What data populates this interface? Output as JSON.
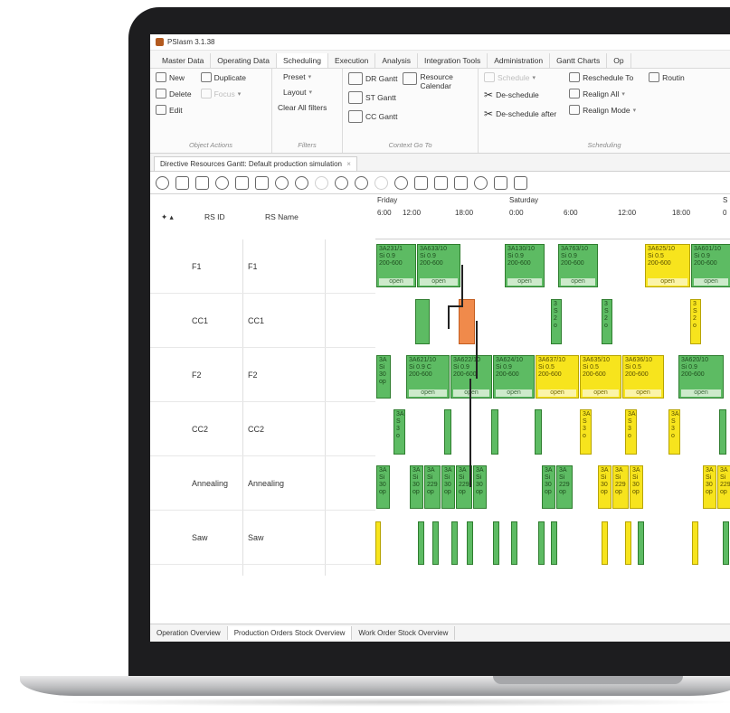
{
  "app": {
    "title": "PSIasm 3.1.38"
  },
  "menu_tabs": [
    "Master Data",
    "Operating Data",
    "Scheduling",
    "Execution",
    "Analysis",
    "Integration Tools",
    "Administration",
    "Gantt Charts",
    "Op"
  ],
  "ribbon": {
    "object_actions": {
      "new": "New",
      "duplicate": "Duplicate",
      "delete": "Delete",
      "focus": "Focus",
      "edit": "Edit",
      "label": "Object Actions"
    },
    "filters": {
      "preset": "Preset",
      "layout": "Layout",
      "clear_all": "Clear All filters",
      "label": "Filters"
    },
    "context_go_to": {
      "dr_gantt": "DR Gantt",
      "resource_calendar_1": "Resource",
      "resource_calendar_2": "Calendar",
      "st_gantt": "ST Gantt",
      "cc_gantt": "CC Gantt",
      "label": "Context Go To"
    },
    "scheduling": {
      "schedule": "Schedule",
      "reschedule_to": "Reschedule To",
      "routing": "Routin",
      "de_schedule": "De-schedule",
      "realign_all": "Realign All",
      "de_schedule_after": "De-schedule after",
      "realign_mode": "Realign Mode",
      "label": "Scheduling"
    }
  },
  "doc_tab": {
    "label": "Directive Resources Gantt: Default production simulation",
    "close": "×"
  },
  "columns": {
    "rs_id": "RS ID",
    "rs_name": "RS Name"
  },
  "timeline": {
    "days": [
      "Friday",
      "Saturday",
      "S"
    ],
    "hours": [
      "6:00",
      "12:00",
      "18:00",
      "0:00",
      "6:00",
      "12:00",
      "18:00",
      "0"
    ]
  },
  "rows": [
    {
      "id": "F1",
      "name": "F1"
    },
    {
      "id": "CC1",
      "name": "CC1"
    },
    {
      "id": "F2",
      "name": "F2"
    },
    {
      "id": "CC2",
      "name": "CC2"
    },
    {
      "id": "Annealing",
      "name": "Annealing"
    },
    {
      "id": "Saw",
      "name": "Saw"
    }
  ],
  "blocks_f1": [
    {
      "l1": "3A231/1",
      "l2": "Si 0.9",
      "l3": "200-600",
      "status": "open",
      "color": "g"
    },
    {
      "l1": "3A633/10",
      "l2": "Si 0.9",
      "l3": "200-600",
      "status": "open",
      "color": "g"
    },
    {
      "l1": "3A130/10",
      "l2": "Si 0.9",
      "l3": "200-600",
      "status": "open",
      "color": "g"
    },
    {
      "l1": "3A763/10",
      "l2": "Si 0.9",
      "l3": "200-600",
      "status": "open",
      "color": "g"
    },
    {
      "l1": "3A625/10",
      "l2": "Si 0.5",
      "l3": "200-600",
      "status": "open",
      "color": "y"
    },
    {
      "l1": "3A601/10",
      "l2": "Si 0.9",
      "l3": "200-600",
      "status": "open",
      "color": "g"
    }
  ],
  "blocks_f2": [
    {
      "l1": "3A",
      "l2": "Si",
      "l3": "30",
      "status": "op",
      "color": "g"
    },
    {
      "l1": "3A621/10",
      "l2": "Si 0.9 C",
      "l3": "200-600",
      "status": "open",
      "color": "g"
    },
    {
      "l1": "3A622/10",
      "l2": "Si 0.9",
      "l3": "200-600",
      "status": "open",
      "color": "g"
    },
    {
      "l1": "3A624/10",
      "l2": "Si 0.9",
      "l3": "200-600",
      "status": "open",
      "color": "g"
    },
    {
      "l1": "3A637/10",
      "l2": "Si 0.5",
      "l3": "200-600",
      "status": "open",
      "color": "y"
    },
    {
      "l1": "3A635/10",
      "l2": "Si 0.5",
      "l3": "200-600",
      "status": "open",
      "color": "y"
    },
    {
      "l1": "3A636/10",
      "l2": "Si 0.5",
      "l3": "200-600",
      "status": "open",
      "color": "y"
    },
    {
      "l1": "3A620/10",
      "l2": "Si 0.9",
      "l3": "200-600",
      "status": "open",
      "color": "g"
    }
  ],
  "small_cc1": [
    {
      "a": "3",
      "b": "S",
      "c": "2",
      "d": "o",
      "color": "g"
    },
    {
      "a": "3",
      "b": "S",
      "c": "2",
      "d": "o",
      "color": "g"
    },
    {
      "a": "3",
      "b": "S",
      "c": "2",
      "d": "o",
      "color": "y"
    }
  ],
  "small_cc2": [
    {
      "a": "3A",
      "b": "S",
      "c": "3",
      "d": "o",
      "color": "g"
    },
    {
      "a": "3A",
      "b": "S",
      "c": "3",
      "d": "o",
      "color": "y"
    },
    {
      "a": "3A",
      "b": "S",
      "c": "3",
      "d": "o",
      "color": "y"
    },
    {
      "a": "3A",
      "b": "S",
      "c": "3",
      "d": "o",
      "color": "y"
    }
  ],
  "annealing": [
    {
      "a": "3A",
      "b": "Si",
      "c": "30",
      "d": "op",
      "color": "g"
    },
    {
      "a": "3A",
      "b": "Si",
      "c": "30",
      "d": "op",
      "color": "g"
    },
    {
      "a": "3A",
      "b": "Si",
      "c": "229",
      "d": "op",
      "color": "g"
    },
    {
      "a": "3A",
      "b": "Si",
      "c": "30",
      "d": "op",
      "color": "g"
    },
    {
      "a": "3A",
      "b": "Si",
      "c": "229",
      "d": "op",
      "color": "g"
    },
    {
      "a": "3A",
      "b": "Si",
      "c": "30",
      "d": "op",
      "color": "g"
    },
    {
      "a": "3A",
      "b": "Si",
      "c": "30",
      "d": "op",
      "color": "g"
    },
    {
      "a": "3A",
      "b": "Si",
      "c": "229",
      "d": "op",
      "color": "g"
    },
    {
      "a": "3A",
      "b": "Si",
      "c": "30",
      "d": "op",
      "color": "y"
    },
    {
      "a": "3A",
      "b": "Si",
      "c": "229",
      "d": "op",
      "color": "y"
    },
    {
      "a": "3A",
      "b": "Si",
      "c": "30",
      "d": "op",
      "color": "y"
    },
    {
      "a": "3A",
      "b": "Si",
      "c": "30",
      "d": "op",
      "color": "y"
    },
    {
      "a": "3A",
      "b": "Si",
      "c": "229",
      "d": "op",
      "color": "y"
    }
  ],
  "bottom_tabs": [
    "Operation Overview",
    "Production Orders Stock Overview",
    "Work Order Stock Overview"
  ],
  "colors": {
    "green": "#5dbb63",
    "yellow": "#f7e41d",
    "orange": "#f08a4b",
    "bezel": "#1d1d1f"
  }
}
